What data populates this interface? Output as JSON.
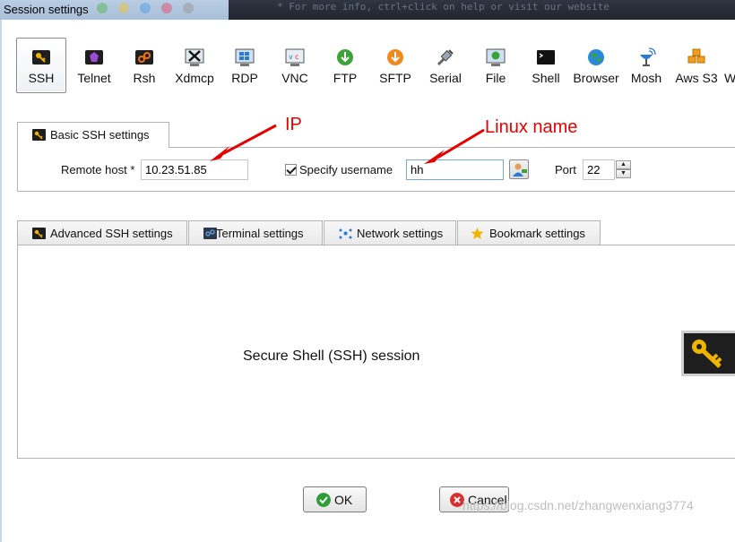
{
  "window": {
    "title": "Session settings"
  },
  "background_terminal_text": "* For more info, ctrl+click on help or visit our website",
  "toolbar": {
    "items": [
      {
        "label": "SSH",
        "icon": "key-icon",
        "active": true
      },
      {
        "label": "Telnet",
        "icon": "telnet-icon"
      },
      {
        "label": "Rsh",
        "icon": "rsh-icon"
      },
      {
        "label": "Xdmcp",
        "icon": "xdmcp-icon"
      },
      {
        "label": "RDP",
        "icon": "rdp-icon"
      },
      {
        "label": "VNC",
        "icon": "vnc-icon"
      },
      {
        "label": "FTP",
        "icon": "ftp-icon"
      },
      {
        "label": "SFTP",
        "icon": "sftp-icon"
      },
      {
        "label": "Serial",
        "icon": "serial-icon"
      },
      {
        "label": "File",
        "icon": "file-icon"
      },
      {
        "label": "Shell",
        "icon": "shell-icon"
      },
      {
        "label": "Browser",
        "icon": "browser-icon"
      },
      {
        "label": "Mosh",
        "icon": "mosh-icon"
      },
      {
        "label": "Aws S3",
        "icon": "aws-s3-icon"
      },
      {
        "label": "W",
        "icon": "wsl-icon"
      }
    ]
  },
  "basic": {
    "tab_label": "Basic SSH settings",
    "remote_host_label": "Remote host *",
    "remote_host_value": "10.23.51.85",
    "specify_username_label": "Specify username",
    "specify_username_checked": true,
    "username_value": "hh",
    "port_label": "Port",
    "port_value": "22"
  },
  "tabs": [
    {
      "label": "Advanced SSH settings",
      "icon": "key-icon"
    },
    {
      "label": "Terminal settings",
      "icon": "terminal-icon"
    },
    {
      "label": "Network settings",
      "icon": "network-icon"
    },
    {
      "label": "Bookmark settings",
      "icon": "star-icon"
    }
  ],
  "content": {
    "description": "Secure Shell (SSH) session"
  },
  "buttons": {
    "ok_label": "OK",
    "cancel_label": "Cancel"
  },
  "annotations": {
    "ip_label": "IP",
    "linux_name_label": "Linux name"
  },
  "watermark": "https://blog.csdn.net/zhangwenxiang3774",
  "colors": {
    "accent_red": "#e60000",
    "key_gold": "#f0b400",
    "ok_green": "#2e9e3a",
    "cancel_red": "#d83030"
  }
}
